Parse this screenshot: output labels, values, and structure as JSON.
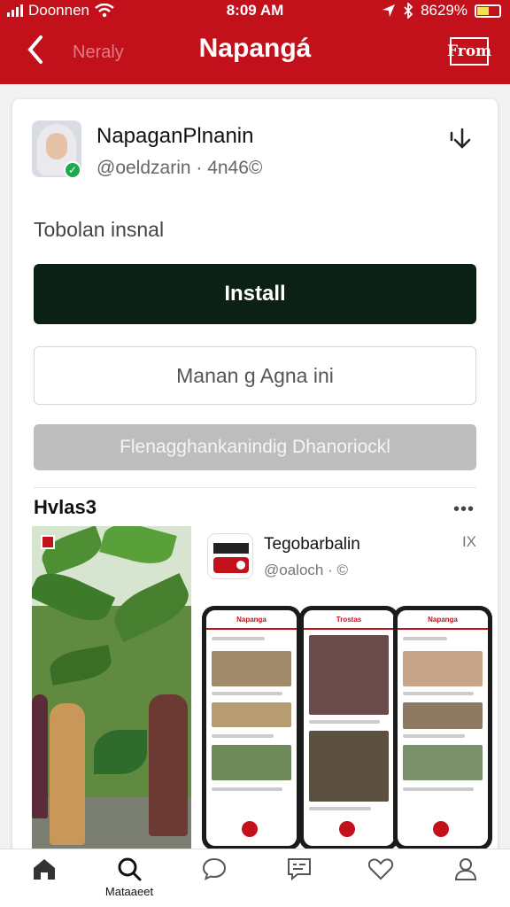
{
  "status_bar": {
    "carrier": "Doonnen",
    "time": "8:09 AM",
    "battery": "8629%",
    "battery_level": 0.55
  },
  "header": {
    "back_icon": "chevron-left-icon",
    "subtitle": "Neraly",
    "title": "Napangá",
    "action_label": "From"
  },
  "app": {
    "name": "NapaganPlnanin",
    "meta": "@oeldzarin · 4n46©",
    "subtitle": "Tobolan insnal",
    "download_icon": "download-icon"
  },
  "buttons": {
    "install": "Install",
    "manage": "Manan g Agna ini",
    "disabled": "Flenagghankanindig Dhanoriockl"
  },
  "section": {
    "title": "Hvlas3",
    "more": "•••"
  },
  "related_app": {
    "name": "Tegobarbalin",
    "meta": "@oaloch · ©",
    "close": "IX"
  },
  "phones": {
    "header_1": "Napanga",
    "header_2": "Trostas",
    "header_3": "Napanga"
  },
  "tabbar": {
    "tabs": [
      {
        "icon": "home-icon",
        "label": ""
      },
      {
        "icon": "search-icon",
        "label": "Mataaeet"
      },
      {
        "icon": "chat-bubble-icon",
        "label": ""
      },
      {
        "icon": "message-icon",
        "label": ""
      },
      {
        "icon": "heart-icon",
        "label": ""
      },
      {
        "icon": "profile-icon",
        "label": ""
      }
    ]
  },
  "colors": {
    "brand_red": "#c2111b",
    "install_bg": "#0c2116"
  }
}
